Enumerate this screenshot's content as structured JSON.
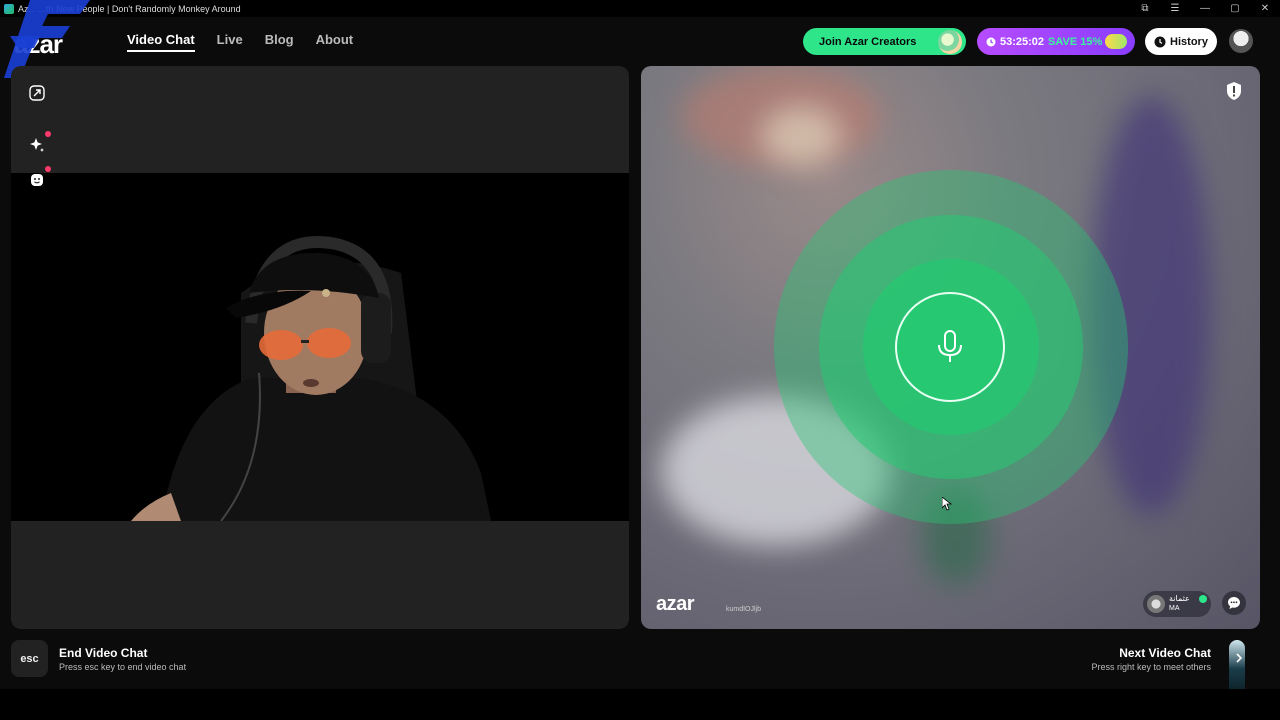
{
  "window": {
    "title": "Az... ...th New People | Don't Randomly Monkey Around",
    "controls": [
      "⧉",
      "☰",
      "—",
      "▢",
      "✕"
    ]
  },
  "header": {
    "logo": "azar",
    "nav": [
      {
        "label": "Video Chat",
        "active": true
      },
      {
        "label": "Live",
        "active": false
      },
      {
        "label": "Blog",
        "active": false
      },
      {
        "label": "About",
        "active": false
      }
    ],
    "join_label": "Join Azar Creators",
    "timer": "53:25:02",
    "save_label": "SAVE 15%",
    "history_label": "History"
  },
  "tools": {
    "expand": "expand-icon",
    "effects": "sparkle-icon",
    "sticker": "face-icon"
  },
  "remote": {
    "watermark": "azar",
    "user_id": "kumdIOJljb",
    "peer_name": "عثمانة",
    "peer_country": "MA"
  },
  "footer": {
    "esc_key": "esc",
    "end_title": "End Video Chat",
    "end_hint": "Press esc key to end video chat",
    "next_title": "Next Video Chat",
    "next_hint": "Press right key to meet others"
  },
  "colors": {
    "accent_green": "#2ee58a",
    "accent_purple": "#9a45ff",
    "mic_green": "#26c872"
  }
}
